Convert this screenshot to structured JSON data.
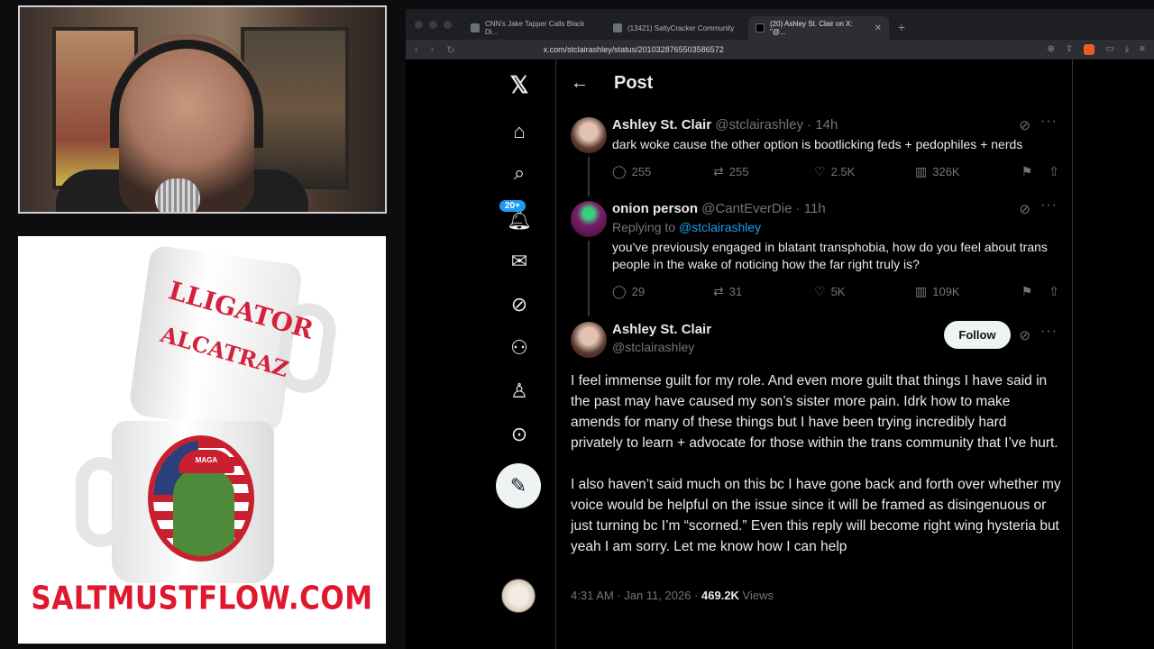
{
  "promo": {
    "mug_text_line1": "LLIGATOR",
    "mug_text_line2": "ALCATRAZ",
    "hat_text": "MAGA",
    "url": "SALTMUSTFLOW.COM"
  },
  "browser": {
    "tabs": [
      {
        "label": "CNN's Jake Tapper Calls Black Di..."
      },
      {
        "label": "(13421) SaltyCracker Community"
      },
      {
        "label": "(20) Ashley St. Clair on X: \"@..."
      }
    ],
    "url": "x.com/stclairashley/status/2010328765503586572"
  },
  "nav": {
    "notifications_badge": "20+"
  },
  "header": {
    "title": "Post"
  },
  "tweets": [
    {
      "name": "Ashley St. Clair",
      "handle": "@stclairashley",
      "time": "· 14h",
      "text": "dark woke cause the other option is bootlicking feds + pedophiles + nerds",
      "replies": "255",
      "reposts": "255",
      "likes": "2.5K",
      "views": "326K"
    },
    {
      "name": "onion person",
      "handle": "@CantEverDie",
      "time": "· 11h",
      "replying_label": "Replying to ",
      "replying_handle": "@stclairashley",
      "text": "you've previously engaged in blatant transphobia, how do you feel about trans people in the wake of noticing how the far right truly is?",
      "replies": "29",
      "reposts": "31",
      "likes": "5K",
      "views": "109K"
    }
  ],
  "focus": {
    "name": "Ashley St. Clair",
    "handle": "@stclairashley",
    "follow_label": "Follow",
    "paragraph1": "I feel immense guilt for my role. And even more guilt that things I have said in the past may have caused my son’s sister more pain. Idrk how to make amends for many of these things but I have been trying incredibly hard privately to learn + advocate for those within the trans community that I’ve hurt.",
    "paragraph2": "I also haven’t said much on this bc I have gone back and forth over whether my voice would be helpful on the issue since it will be framed as disingenuous or just turning bc I’m “scorned.” Even this reply will become right wing hysteria but yeah I am sorry. Let me know how I can help",
    "timestamp": "4:31 AM · Jan 11, 2026 · ",
    "views_count": "469.2K",
    "views_label": " Views"
  }
}
